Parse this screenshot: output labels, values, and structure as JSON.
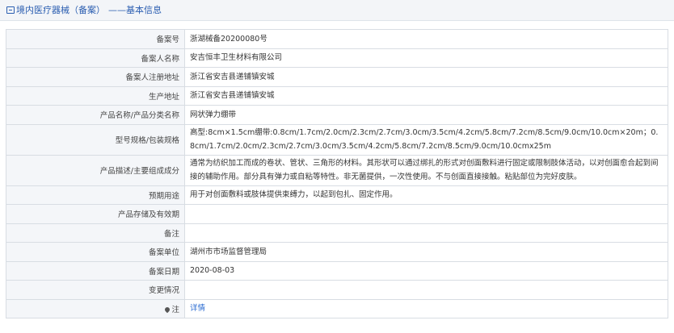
{
  "header": {
    "title": "境内医疗器械（备案）",
    "subtitle": "——基本信息"
  },
  "rows": [
    {
      "label": "备案号",
      "value": "浙湖械备20200080号"
    },
    {
      "label": "备案人名称",
      "value": "安吉恒丰卫生材料有限公司"
    },
    {
      "label": "备案人注册地址",
      "value": "浙江省安吉县递铺镇安城"
    },
    {
      "label": "生产地址",
      "value": "浙江省安吉县递铺镇安城"
    },
    {
      "label": "产品名称/产品分类名称",
      "value": "网状弹力绷带"
    },
    {
      "label": "型号规格/包装规格",
      "value": "高型:8cm×1.5cm绷带:0.8cm/1.7cm/2.0cm/2.3cm/2.7cm/3.0cm/3.5cm/4.2cm/5.8cm/7.2cm/8.5cm/9.0cm/10.0cm×20m；0.8cm/1.7cm/2.0cm/2.3cm/2.7cm/3.0cm/3.5cm/4.2cm/5.8cm/7.2cm/8.5cm/9.0cm/10.0cmx25m"
    },
    {
      "label": "产品描述/主要组成成分",
      "value": "通常为纺织加工而成的卷状、管状、三角形的材料。其形状可以通过绑扎的形式对创面敷料进行固定或限制肢体活动，以对创面愈合起到间接的辅助作用。部分具有弹力或自粘等特性。非无菌提供，一次性使用。不与创面直接接触。粘贴部位为完好皮肤。"
    },
    {
      "label": "预期用途",
      "value": "用于对创面敷料或肢体提供束缚力，以起到包扎、固定作用。"
    },
    {
      "label": "产品存储及有效期",
      "value": ""
    },
    {
      "label": "备注",
      "value": ""
    },
    {
      "label": "备案单位",
      "value": "湖州市市场监督管理局"
    },
    {
      "label": "备案日期",
      "value": "2020-08-03"
    },
    {
      "label": "变更情况",
      "value": ""
    }
  ],
  "note_row": {
    "label": "注",
    "icon": "pin-icon",
    "link_text": "详情"
  }
}
